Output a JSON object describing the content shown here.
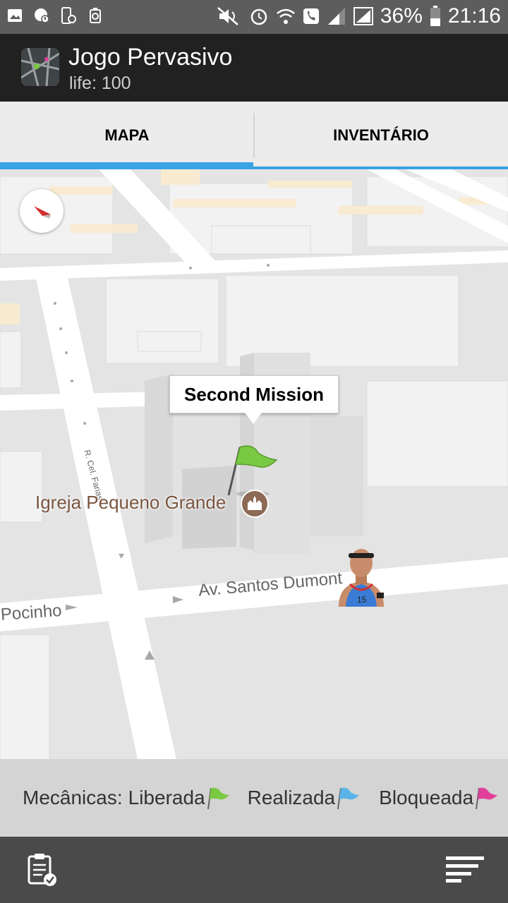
{
  "status_bar": {
    "battery_percent": "36%",
    "time": "21:16",
    "left_icons": [
      "image-icon",
      "chat-alert-icon",
      "phone-clock-icon",
      "recycle-icon"
    ],
    "right_icons": [
      "mute-icon",
      "alarm-icon",
      "wifi-call-icon",
      "phone-icon",
      "signal-icon",
      "signal-icon",
      "battery-icon"
    ]
  },
  "app_bar": {
    "title": "Jogo Pervasivo",
    "subtitle": "life: 100",
    "icon": "map-app-icon"
  },
  "tabs": [
    {
      "label": "MAPA",
      "selected": true
    },
    {
      "label": "INVENTÁRIO",
      "selected": false
    }
  ],
  "map": {
    "callout": "Second Mission",
    "poi_label": "Igreja Pequeno Grande",
    "streets": {
      "avenue": "Av. Santos Dumont",
      "left_street": "Pocinho",
      "vertical_street": "R. Cel. Farias"
    },
    "mission_flag_color": "#7ac943",
    "poi_icon": "church-icon",
    "player_icon": "basketball-player-icon",
    "player_number": "15"
  },
  "legend": {
    "prefix": "Mecânicas:",
    "items": [
      {
        "label": "Liberada",
        "color": "#7ac943",
        "icon": "green-flag-icon"
      },
      {
        "label": "Realizada",
        "color": "#5ab4e8",
        "icon": "blue-flag-icon"
      },
      {
        "label": "Bloqueada",
        "color": "#e0409a",
        "icon": "pink-flag-icon"
      }
    ]
  },
  "bottom_bar": {
    "left_icon": "clipboard-check-icon",
    "right_icon": "sort-lines-icon"
  },
  "colors": {
    "tab_indicator": "#3aa3e3",
    "app_bar": "#212121",
    "status_bar": "#5d5d5d"
  }
}
